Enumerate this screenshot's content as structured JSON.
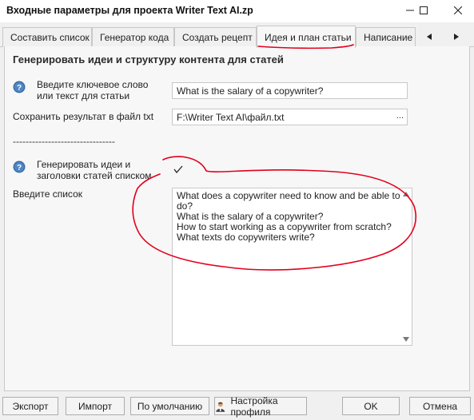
{
  "window": {
    "title": "Входные параметры для проекта Writer Text AI.zp"
  },
  "tabs": [
    {
      "label": "Составить список",
      "active": false
    },
    {
      "label": "Генератор кода",
      "active": false
    },
    {
      "label": "Создать рецепт",
      "active": false
    },
    {
      "label": "Идея и план статьи",
      "active": true
    },
    {
      "label": "Написание ст",
      "active": false
    }
  ],
  "panel": {
    "section_title": "Генерировать идеи и структуру контента для статей",
    "keyword": {
      "label": "Введите ключевое слово или текст для статьи",
      "value": "What is the salary of a copywriter?"
    },
    "save_file": {
      "label": "Сохранить результат в файл txt",
      "value": "F:\\Writer Text AI\\файл.txt",
      "browse_label": "..."
    },
    "separator": "--------------------------------",
    "generate_list": {
      "label": "Генерировать идеи и заголовки статей списком",
      "checked": true
    },
    "list": {
      "label": "Введите список",
      "lines": [
        "What does a copywriter need to know and be able to",
        "do?",
        "What is the salary of a copywriter?",
        "How to start working as a copywriter from scratch?",
        "What texts do copywriters write?"
      ]
    }
  },
  "footer": {
    "export": "Экспорт",
    "import": "Импорт",
    "defaults": "По умолчанию",
    "profile_settings": "Настройка профиля",
    "ok": "OK",
    "cancel": "Отмена"
  },
  "colors": {
    "annotation": "#e3001b",
    "help_icon": "#3a6ea5"
  }
}
